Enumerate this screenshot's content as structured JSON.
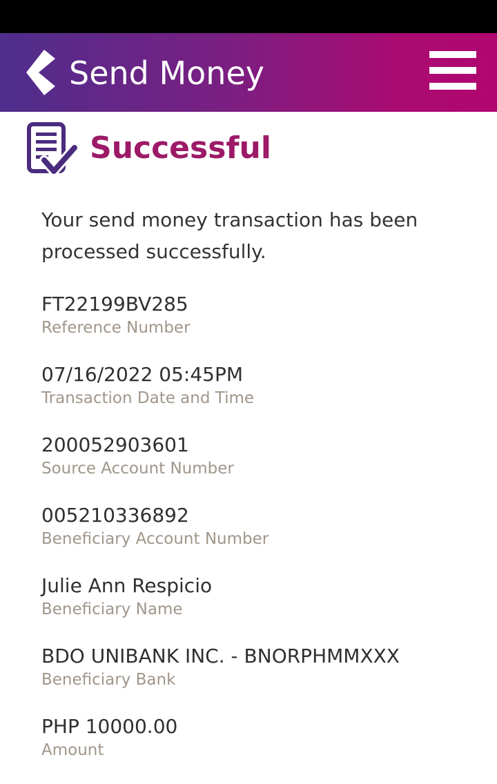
{
  "header": {
    "title": "Send Money",
    "back_icon": "chevron-left-icon",
    "menu_icon": "hamburger-menu-icon",
    "gradient_start": "#4e2e8c",
    "gradient_end": "#b1066f"
  },
  "status": {
    "title": "Successful",
    "icon": "document-checkmark-icon",
    "title_color": "#9c1a67",
    "icon_color": "#4b2c7e"
  },
  "message": "Your send money transaction has been processed successfully.",
  "details": [
    {
      "value": "FT22199BV285",
      "label": "Reference Number"
    },
    {
      "value": "07/16/2022 05:45PM",
      "label": "Transaction Date and Time"
    },
    {
      "value": "200052903601",
      "label": "Source Account Number"
    },
    {
      "value": "005210336892",
      "label": "Beneficiary Account Number"
    },
    {
      "value": "Julie Ann Respicio",
      "label": "Beneficiary Name"
    },
    {
      "value": "BDO UNIBANK INC. - BNORPHMMXXX",
      "label": "Beneficiary Bank"
    },
    {
      "value": "PHP 10000.00",
      "label": "Amount"
    }
  ]
}
